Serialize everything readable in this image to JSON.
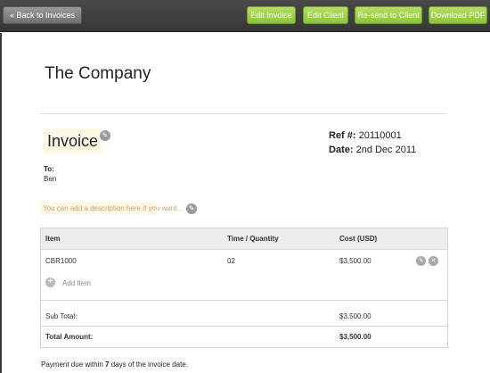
{
  "toolbar": {
    "back_label": "« Back to Invoices",
    "edit_invoice_label": "Edit Invoice",
    "edit_client_label": "Edit Client",
    "resend_label": "Re-send to Client",
    "download_label": "Download PDF"
  },
  "company": {
    "name": "The Company"
  },
  "invoice": {
    "title": "Invoice",
    "ref_label": "Ref #:",
    "ref_value": "20110001",
    "date_label": "Date:",
    "date_value": "2nd Dec 2011",
    "to_label": "To:",
    "to_name": "Ben",
    "description_placeholder": "You can add a description here if you want..."
  },
  "table": {
    "headers": {
      "item": "Item",
      "time": "Time / Quantity",
      "cost": "Cost (USD)"
    },
    "rows": [
      {
        "item": "CBR1000",
        "quantity": "02",
        "cost": "$3,500.00"
      }
    ],
    "add_item_label": "Add Item",
    "subtotal_label": "Sub Total:",
    "subtotal_value": "$3,500.00",
    "total_label": "Total Amount:",
    "total_value": "$3,500.00"
  },
  "footer": {
    "prefix": "Payment due within ",
    "days": "7",
    "suffix": " days of the invoice date."
  },
  "icons": {
    "pencil": "pencil-icon",
    "delete": "delete-icon",
    "add": "plus-icon"
  },
  "colors": {
    "toolbar_bg": "#3e3e3e",
    "button_green": "#9fd24a",
    "highlight": "#fdf7e6",
    "placeholder_text": "#c8a66a"
  }
}
